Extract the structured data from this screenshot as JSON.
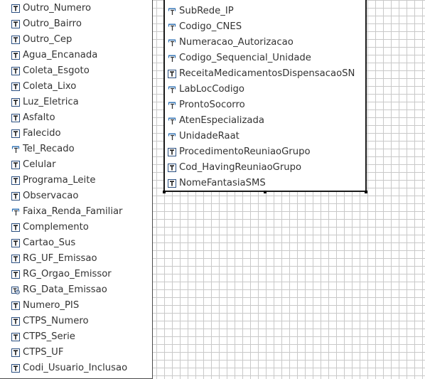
{
  "left_table": {
    "fields": [
      {
        "name": "Outro_Numero",
        "icon": "text-field-icon"
      },
      {
        "name": "Outro_Bairro",
        "icon": "text-field-icon"
      },
      {
        "name": "Outro_Cep",
        "icon": "text-field-icon"
      },
      {
        "name": "Agua_Encanada",
        "icon": "text-field-icon"
      },
      {
        "name": "Coleta_Esgoto",
        "icon": "text-field-icon"
      },
      {
        "name": "Coleta_Lixo",
        "icon": "text-field-icon"
      },
      {
        "name": "Luz_Eletrica",
        "icon": "text-field-icon"
      },
      {
        "name": "Asfalto",
        "icon": "text-field-icon"
      },
      {
        "name": "Falecido",
        "icon": "text-field-icon"
      },
      {
        "name": "Tel_Recado",
        "icon": "numeric-field-icon"
      },
      {
        "name": "Celular",
        "icon": "text-field-icon"
      },
      {
        "name": "Programa_Leite",
        "icon": "text-field-icon"
      },
      {
        "name": "Observacao",
        "icon": "text-field-icon"
      },
      {
        "name": "Faixa_Renda_Familiar",
        "icon": "numeric-field-icon"
      },
      {
        "name": "Complemento",
        "icon": "text-field-icon"
      },
      {
        "name": "Cartao_Sus",
        "icon": "text-field-icon"
      },
      {
        "name": "RG_UF_Emissao",
        "icon": "text-field-icon"
      },
      {
        "name": "RG_Orgao_Emissor",
        "icon": "text-field-icon"
      },
      {
        "name": "RG_Data_Emissao",
        "icon": "date-field-icon"
      },
      {
        "name": "Numero_PIS",
        "icon": "text-field-icon"
      },
      {
        "name": "CTPS_Numero",
        "icon": "text-field-icon"
      },
      {
        "name": "CTPS_Serie",
        "icon": "text-field-icon"
      },
      {
        "name": "CTPS_UF",
        "icon": "text-field-icon"
      },
      {
        "name": "Codi_Usuario_Inclusao",
        "icon": "text-field-icon"
      }
    ]
  },
  "right_table": {
    "fields": [
      {
        "name": "SubRede_IP",
        "icon": "numeric-field-icon"
      },
      {
        "name": "Codigo_CNES",
        "icon": "numeric-field-icon"
      },
      {
        "name": "Numeracao_Autorizacao",
        "icon": "numeric-field-icon"
      },
      {
        "name": "Codigo_Sequencial_Unidade",
        "icon": "numeric-field-icon"
      },
      {
        "name": "ReceitaMedicamentosDispensacaoSN",
        "icon": "text-field-icon"
      },
      {
        "name": "LabLocCodigo",
        "icon": "numeric-field-icon"
      },
      {
        "name": "ProntoSocorro",
        "icon": "numeric-field-icon"
      },
      {
        "name": "AtenEspecializada",
        "icon": "numeric-field-icon"
      },
      {
        "name": "UnidadeRaat",
        "icon": "numeric-field-icon"
      },
      {
        "name": "ProcedimentoReuniaoGrupo",
        "icon": "text-field-icon"
      },
      {
        "name": "Cod_HavingReuniaoGrupo",
        "icon": "text-field-icon"
      },
      {
        "name": "NomeFantasiaSMS",
        "icon": "text-field-icon"
      }
    ]
  }
}
